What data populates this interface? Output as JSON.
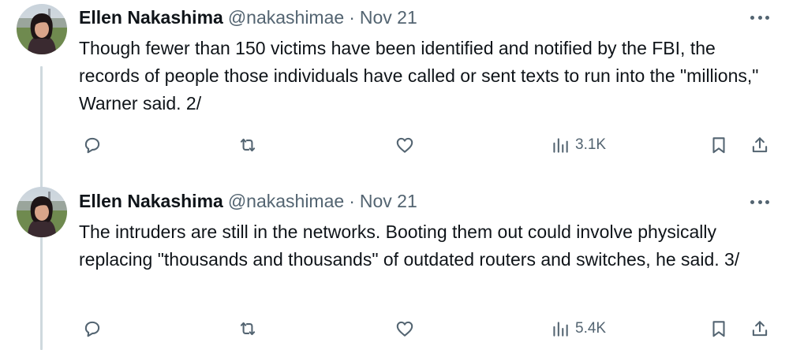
{
  "tweets": [
    {
      "author": "Ellen Nakashima",
      "handle": "@nakashimae",
      "separator": "·",
      "date": "Nov 21",
      "text": "Though fewer than 150 victims have been identified and notified by the FBI, the records of people those individuals have called or sent texts to run into the \"millions,\" Warner said. 2/",
      "views": "3.1K"
    },
    {
      "author": "Ellen Nakashima",
      "handle": "@nakashimae",
      "separator": "·",
      "date": "Nov 21",
      "text": "The intruders are still in the networks. Booting them out could involve physically replacing \"thousands and thousands\" of outdated routers and switches, he said. 3/",
      "views": "5.4K"
    }
  ],
  "icons": {
    "more": "more-icon",
    "reply": "reply-icon",
    "repost": "repost-icon",
    "like": "heart-icon",
    "views": "views-icon",
    "bookmark": "bookmark-icon",
    "share": "share-icon"
  },
  "colors": {
    "text": "#0f1419",
    "secondary": "#536471",
    "thread_line": "#cfd9de"
  }
}
